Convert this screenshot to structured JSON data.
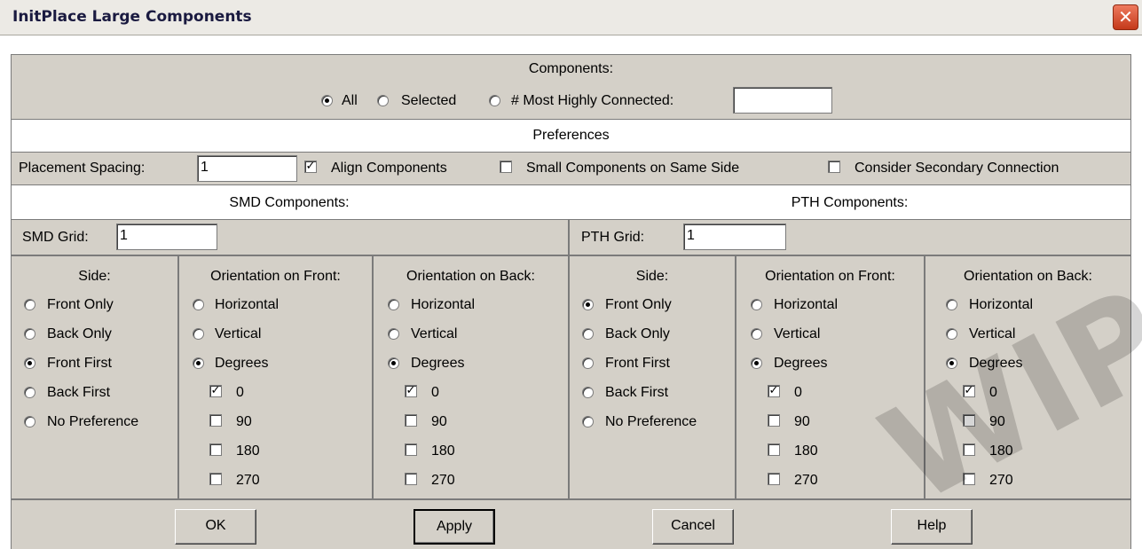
{
  "window": {
    "title": "InitPlace Large Components",
    "close_icon": "close-icon"
  },
  "components": {
    "heading": "Components:",
    "options": [
      {
        "label": "All",
        "selected": true
      },
      {
        "label": "Selected",
        "selected": false
      },
      {
        "label": "# Most Highly Connected:",
        "selected": false
      }
    ],
    "most_connected_value": ""
  },
  "preferences": {
    "heading": "Preferences",
    "placement_spacing_label": "Placement Spacing:",
    "placement_spacing_value": "1",
    "align_components": {
      "label": "Align Components",
      "checked": true
    },
    "small_same_side": {
      "label": "Small Components on Same Side",
      "checked": false
    },
    "consider_secondary": {
      "label": "Consider Secondary Connection",
      "checked": false
    }
  },
  "smd": {
    "heading": "SMD Components:",
    "grid_label": "SMD Grid:",
    "grid_value": "1",
    "side": {
      "heading": "Side:",
      "options": [
        "Front Only",
        "Back Only",
        "Front First",
        "Back First",
        "No Preference"
      ],
      "selected": 2
    },
    "front": {
      "heading": "Orientation on Front:",
      "options": [
        "Horizontal",
        "Vertical",
        "Degrees"
      ],
      "selected": 2,
      "degrees": [
        {
          "label": "0",
          "checked": true
        },
        {
          "label": "90",
          "checked": false
        },
        {
          "label": "180",
          "checked": false
        },
        {
          "label": "270",
          "checked": false
        }
      ]
    },
    "back": {
      "heading": "Orientation on Back:",
      "options": [
        "Horizontal",
        "Vertical",
        "Degrees"
      ],
      "selected": 2,
      "degrees": [
        {
          "label": "0",
          "checked": true
        },
        {
          "label": "90",
          "checked": false
        },
        {
          "label": "180",
          "checked": false
        },
        {
          "label": "270",
          "checked": false
        }
      ]
    }
  },
  "pth": {
    "heading": "PTH Components:",
    "grid_label": "PTH Grid:",
    "grid_value": "1",
    "side": {
      "heading": "Side:",
      "options": [
        "Front Only",
        "Back Only",
        "Front First",
        "Back First",
        "No Preference"
      ],
      "selected": 0
    },
    "front": {
      "heading": "Orientation on Front:",
      "options": [
        "Horizontal",
        "Vertical",
        "Degrees"
      ],
      "selected": 2,
      "degrees": [
        {
          "label": "0",
          "checked": true
        },
        {
          "label": "90",
          "checked": false
        },
        {
          "label": "180",
          "checked": false
        },
        {
          "label": "270",
          "checked": false
        }
      ]
    },
    "back": {
      "heading": "Orientation on Back:",
      "options": [
        "Horizontal",
        "Vertical",
        "Degrees"
      ],
      "selected": 2,
      "degrees": [
        {
          "label": "0",
          "checked": true
        },
        {
          "label": "90",
          "checked": false
        },
        {
          "label": "180",
          "checked": false
        },
        {
          "label": "270",
          "checked": false
        }
      ]
    }
  },
  "buttons": {
    "ok": "OK",
    "apply": "Apply",
    "cancel": "Cancel",
    "help": "Help"
  },
  "watermark": "WIP"
}
